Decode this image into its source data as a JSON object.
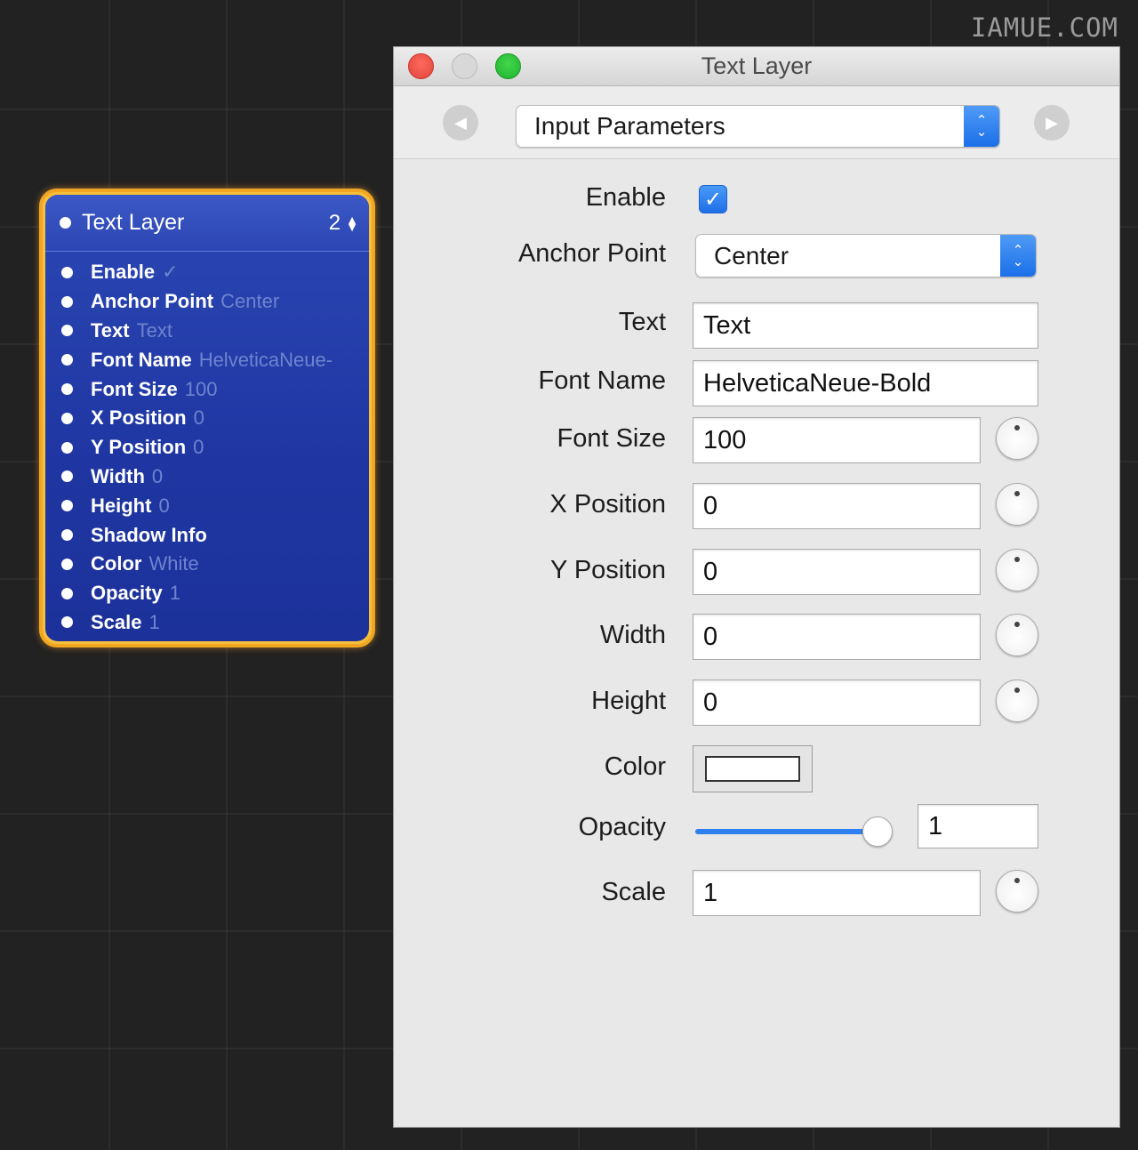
{
  "watermark": "IAMUE.COM",
  "node": {
    "title": "Text Layer",
    "count": "2",
    "ports": [
      {
        "name": "Enable",
        "value": "✓"
      },
      {
        "name": "Anchor Point",
        "value": "Center"
      },
      {
        "name": "Text",
        "value": "Text"
      },
      {
        "name": "Font Name",
        "value": "HelveticaNeue-"
      },
      {
        "name": "Font Size",
        "value": "100"
      },
      {
        "name": "X Position",
        "value": "0"
      },
      {
        "name": "Y Position",
        "value": "0"
      },
      {
        "name": "Width",
        "value": "0"
      },
      {
        "name": "Height",
        "value": "0"
      },
      {
        "name": "Shadow Info",
        "value": ""
      },
      {
        "name": "Color",
        "value": "White"
      },
      {
        "name": "Opacity",
        "value": "1"
      },
      {
        "name": "Scale",
        "value": "1"
      }
    ]
  },
  "inspector": {
    "title": "Text Layer",
    "pane_select": "Input Parameters",
    "labels": {
      "enable": "Enable",
      "anchor_point": "Anchor Point",
      "text": "Text",
      "font_name": "Font Name",
      "font_size": "Font Size",
      "x_position": "X Position",
      "y_position": "Y Position",
      "width": "Width",
      "height": "Height",
      "color": "Color",
      "opacity": "Opacity",
      "scale": "Scale"
    },
    "values": {
      "enable": true,
      "anchor_point": "Center",
      "text": "Text",
      "font_name": "HelveticaNeue-Bold",
      "font_size": "100",
      "x_position": "0",
      "y_position": "0",
      "width": "0",
      "height": "0",
      "color": "#ffffff",
      "opacity": "1",
      "opacity_slider_fraction": 0.95,
      "scale": "1"
    }
  },
  "colors": {
    "node_fill": "#2340aa",
    "node_border": "#f1a623",
    "accent_blue": "#2e7ff0",
    "canvas_bg": "#222222"
  },
  "icons": {
    "prev": "chevron-left-icon",
    "next": "chevron-right-icon",
    "stepper": "up-down-arrows-icon",
    "checkmark": "checkmark-icon"
  }
}
